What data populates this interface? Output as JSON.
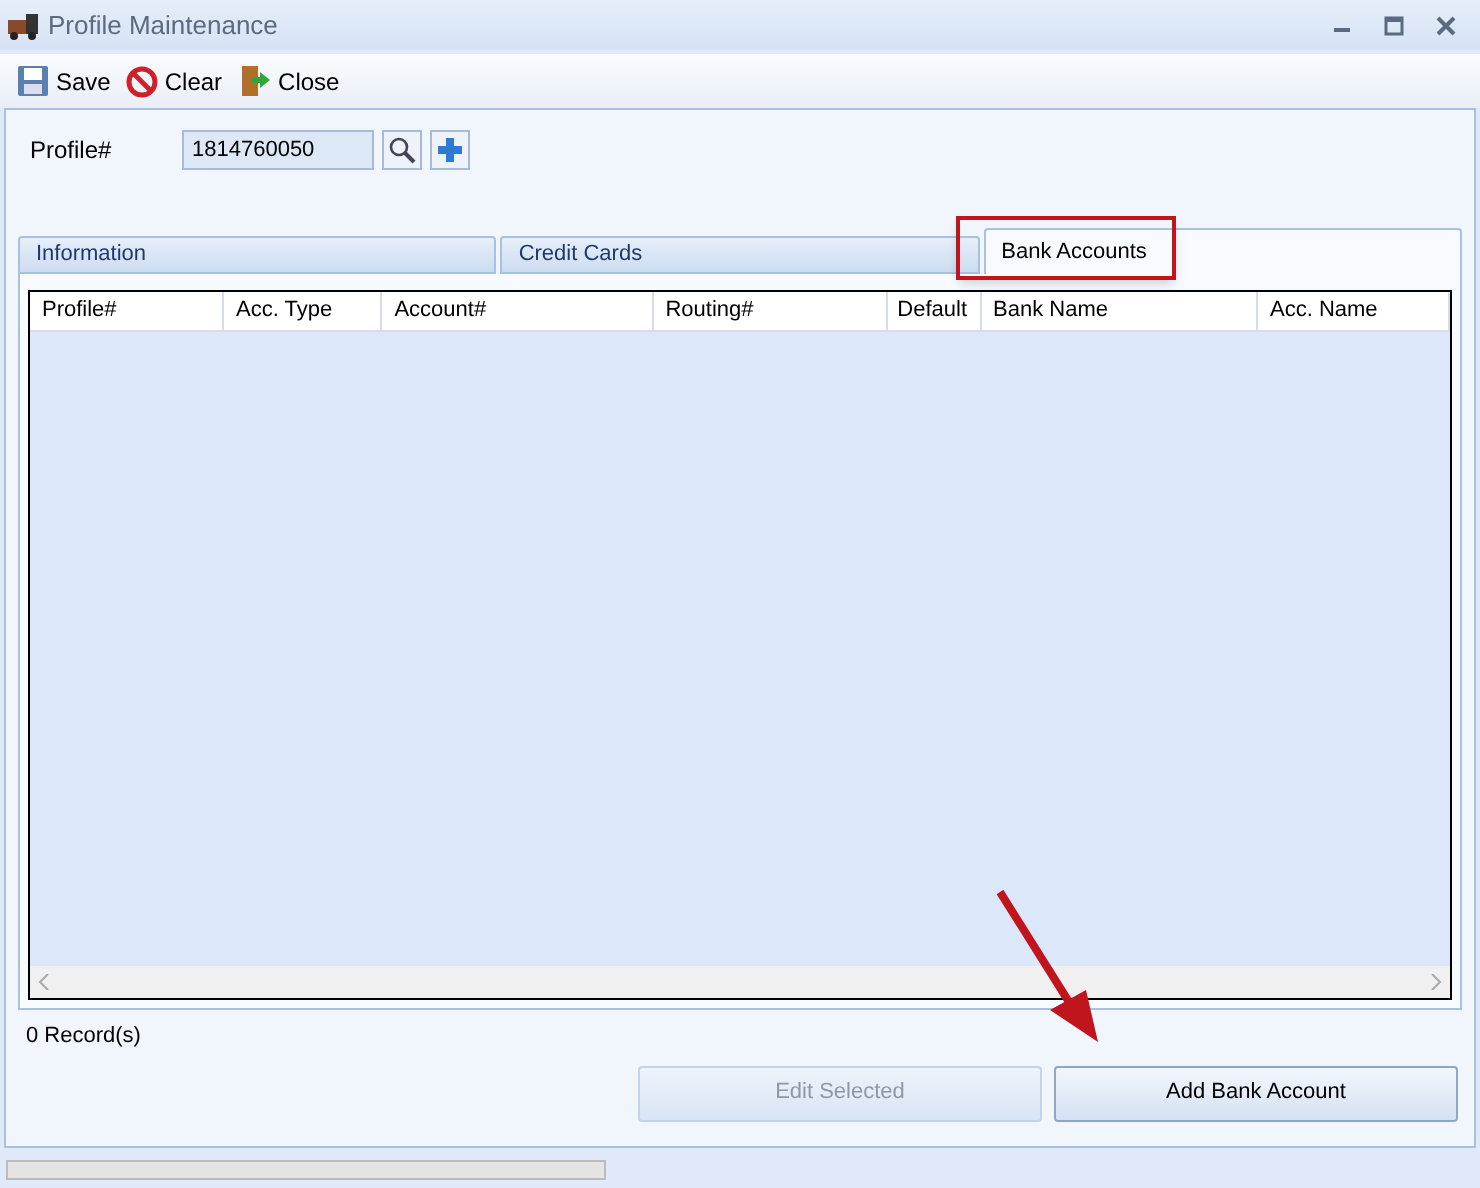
{
  "window": {
    "title": "Profile Maintenance"
  },
  "toolbar": [
    {
      "label": "Save",
      "kind": "save"
    },
    {
      "label": "Clear",
      "kind": "clear"
    },
    {
      "label": "Close",
      "kind": "close"
    }
  ],
  "profile": {
    "label": "Profile#",
    "value": "1814760050"
  },
  "tabs": [
    {
      "label": "Information",
      "selected": false
    },
    {
      "label": "Credit Cards",
      "selected": false
    },
    {
      "label": "Bank Accounts",
      "selected": true
    }
  ],
  "table": {
    "columns": [
      "Profile#",
      "Acc. Type",
      "Account#",
      "Routing#",
      "Default",
      "Bank Name",
      "Acc. Name"
    ]
  },
  "record_count": "0 Record(s)",
  "buttons": [
    {
      "label": "Edit Selected",
      "disabled": true
    },
    {
      "label": "Add Bank Account",
      "disabled": false
    }
  ]
}
